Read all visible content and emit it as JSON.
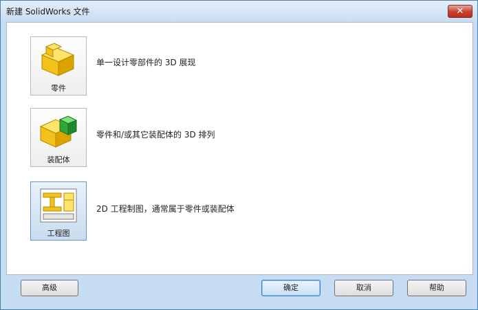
{
  "window": {
    "title": "新建 SolidWorks 文件"
  },
  "templates": [
    {
      "label": "零件",
      "description": "单一设计零部件的 3D 展现"
    },
    {
      "label": "装配体",
      "description": "零件和/或其它装配体的 3D 排列"
    },
    {
      "label": "工程图",
      "description": "2D 工程制图，通常属于零件或装配体"
    }
  ],
  "buttons": {
    "advanced": "高级",
    "ok": "确定",
    "cancel": "取消",
    "help": "帮助"
  },
  "colors": {
    "part_yellow": "#f2c21a",
    "assembly_green": "#2ea83a",
    "drawing_frame": "#f2c21a"
  }
}
